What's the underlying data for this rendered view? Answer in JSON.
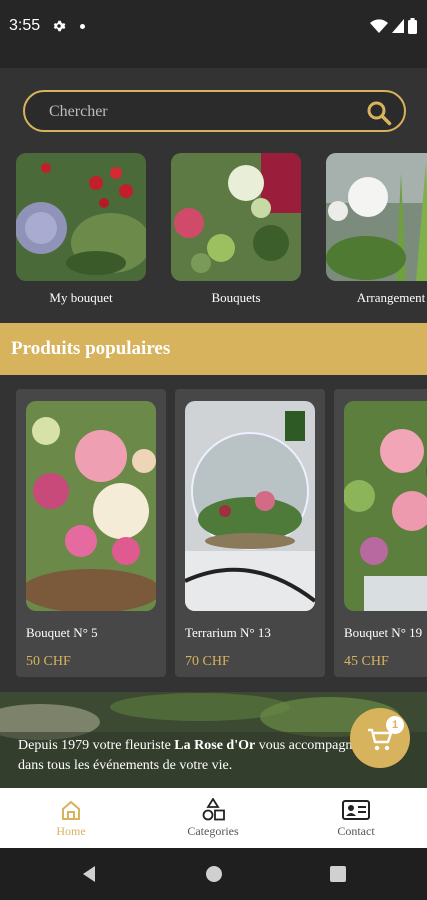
{
  "status_bar": {
    "time": "3:55"
  },
  "search": {
    "placeholder": "Chercher"
  },
  "categories": [
    {
      "label": "My bouquet"
    },
    {
      "label": "Bouquets"
    },
    {
      "label": "Arrangement"
    }
  ],
  "popular": {
    "title": "Produits populaires"
  },
  "products": [
    {
      "name": "Bouquet N° 5",
      "price": "50 CHF"
    },
    {
      "name": "Terrarium N° 13",
      "price": "70 CHF"
    },
    {
      "name": "Bouquet N° 19",
      "price": "45 CHF"
    }
  ],
  "banner": {
    "text_before": "Depuis 1979 votre fleuriste ",
    "brand": "La Rose d'Or",
    "text_after": " vous accompagne",
    "line2": "dans tous les événements de votre vie."
  },
  "cart": {
    "badge": "1"
  },
  "bottom_nav": [
    {
      "label": "Home",
      "icon": "home-icon",
      "active": true
    },
    {
      "label": "Categories",
      "icon": "categories-icon",
      "active": false
    },
    {
      "label": "Contact",
      "icon": "contact-icon",
      "active": false
    }
  ],
  "colors": {
    "accent": "#d8b35d",
    "background": "#333333",
    "card": "#474747"
  }
}
